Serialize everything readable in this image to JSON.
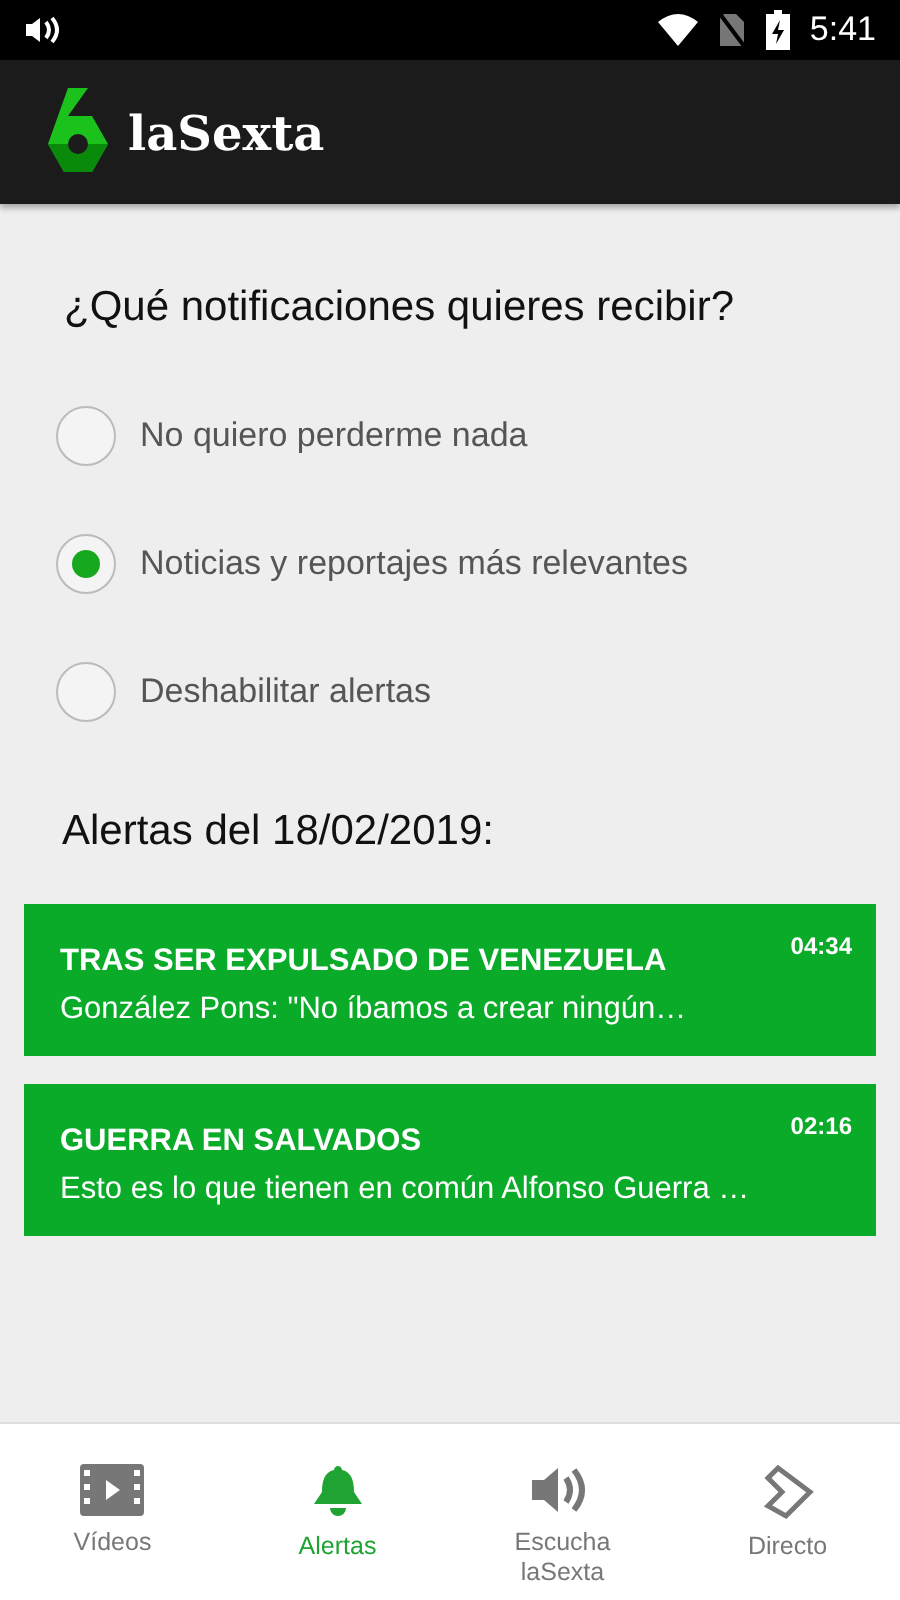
{
  "status_bar": {
    "time": "5:41"
  },
  "app_bar": {
    "logo_text": "laSexta"
  },
  "question": "¿Qué notificaciones quieres recibir?",
  "options": [
    {
      "label": "No quiero perderme nada",
      "selected": false
    },
    {
      "label": "Noticias y reportajes más relevantes",
      "selected": true
    },
    {
      "label": "Deshabilitar alertas",
      "selected": false
    }
  ],
  "alerts_heading": "Alertas del 18/02/2019:",
  "alerts": [
    {
      "title": "TRAS SER EXPULSADO DE VENEZUELA",
      "summary": "González Pons: \"No íbamos a crear ningún…",
      "time": "04:34"
    },
    {
      "title": "GUERRA EN SALVADOS",
      "summary": "Esto es lo que tienen en común Alfonso Guerra …",
      "time": "02:16"
    }
  ],
  "nav": [
    {
      "kind": "video",
      "label": "Vídeos",
      "selected": false
    },
    {
      "kind": "bell",
      "label": "Alertas",
      "selected": true
    },
    {
      "kind": "speaker",
      "label": "Escucha laSexta",
      "selected": false
    },
    {
      "kind": "live",
      "label": "Directo",
      "selected": false
    }
  ]
}
